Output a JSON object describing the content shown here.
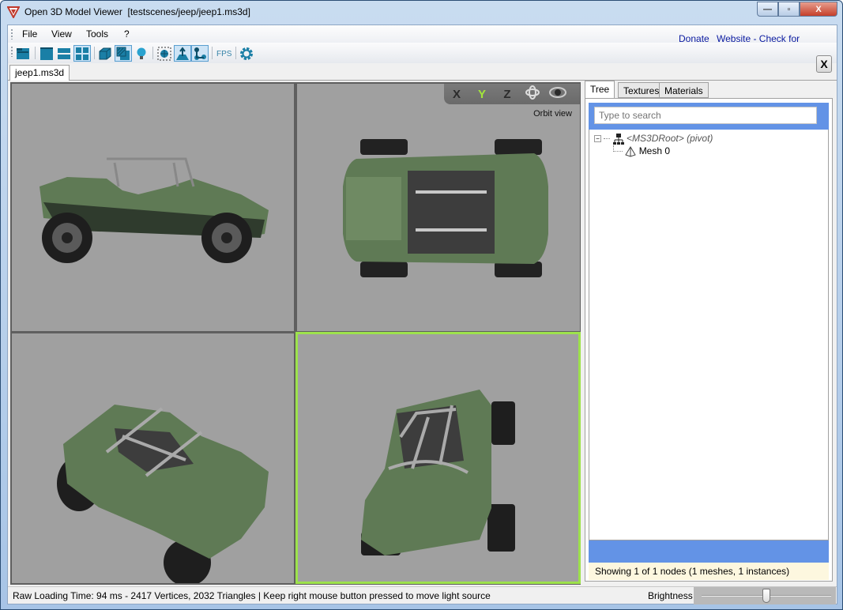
{
  "window": {
    "title": "Open 3D Model Viewer  [testscenes/jeep/jeep1.ms3d]",
    "controls": {
      "minimize": "—",
      "maximize": "▫",
      "close": "X"
    }
  },
  "menu": {
    "items": [
      {
        "label": "File"
      },
      {
        "label": "View"
      },
      {
        "label": "Tools"
      },
      {
        "label": "?"
      }
    ],
    "links": {
      "donate": "Donate",
      "website": "Website - Check for Updates"
    }
  },
  "toolbar": {
    "buttons": [
      {
        "icon": "open-folder-icon",
        "active": false
      },
      {
        "icon": "single-view-icon",
        "active": false
      },
      {
        "icon": "two-views-icon",
        "active": false
      },
      {
        "icon": "four-views-icon",
        "active": true
      },
      {
        "icon": "wireframe-icon",
        "active": false
      },
      {
        "icon": "textured-icon",
        "active": true
      },
      {
        "icon": "lightbulb-icon",
        "active": false
      },
      {
        "icon": "bounding-box-icon",
        "active": false
      },
      {
        "icon": "normals-icon",
        "active": true
      },
      {
        "icon": "skeleton-icon",
        "active": true
      },
      {
        "icon": "settings-gear-icon",
        "active": false
      }
    ],
    "fps_label": "FPS"
  },
  "document_tabs": [
    {
      "label": "jeep1.ms3d",
      "active": true
    }
  ],
  "close_doc_label": "X",
  "viewport": {
    "axes": [
      "X",
      "Y",
      "Z"
    ],
    "active_axis": "Y",
    "mode_label": "Orbit view",
    "views": [
      "side",
      "top",
      "perspective",
      "front-perspective"
    ],
    "active_view": 4,
    "accent": "#9de24b"
  },
  "side_panel": {
    "tabs": [
      {
        "label": "Tree",
        "active": true
      },
      {
        "label": "Textures",
        "active": false
      },
      {
        "label": "Materials",
        "active": false
      }
    ],
    "search_placeholder": "Type to search",
    "tree": {
      "root": {
        "label": "<MS3DRoot> (pivot)",
        "children": [
          {
            "label": "Mesh 0"
          }
        ]
      }
    },
    "status": "Showing 1 of 1 nodes (1 meshes, 1 instances)"
  },
  "statusbar": {
    "text": "Raw Loading Time: 94 ms - 2417 Vertices, 2032 Triangles  | Keep right mouse button pressed to move light source",
    "brightness_label": "Brightness",
    "brightness_value": 0.5
  }
}
